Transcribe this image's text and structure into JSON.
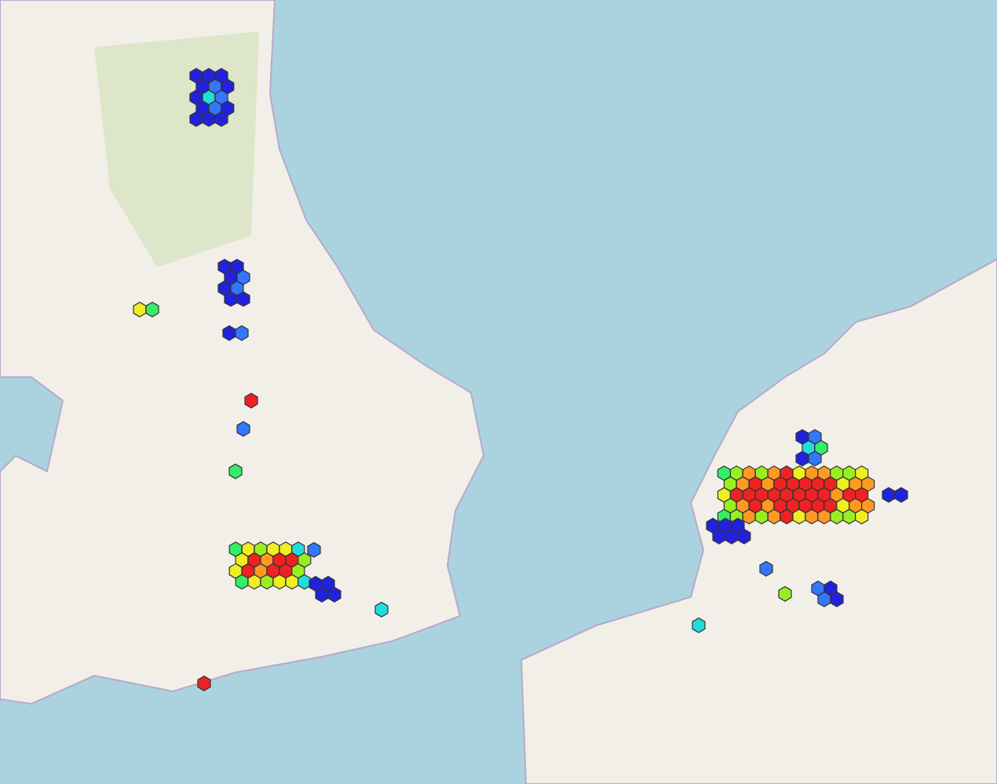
{
  "map": {
    "hexbin_overlay": true
  }
}
